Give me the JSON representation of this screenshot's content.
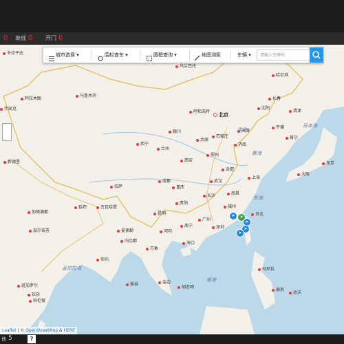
{
  "status": {
    "items": [
      {
        "label": "",
        "value": "0"
      },
      {
        "label": "离线",
        "value": "0"
      },
      {
        "label": "开门",
        "value": "0"
      }
    ]
  },
  "toolbar": {
    "city_select": "城市选择",
    "fence_search": "围栏查车",
    "box_search": "圆框查询",
    "measure": "地图测距",
    "vehicle_label": "车辆",
    "plate_placeholder": "请输入车牌号"
  },
  "map": {
    "labels": [
      {
        "text": "卡拉干达",
        "kind": "city"
      },
      {
        "text": "乌兰巴托",
        "kind": "city"
      },
      {
        "text": "哈尔滨",
        "kind": "city"
      },
      {
        "text": "乌鲁木齐",
        "kind": "city"
      },
      {
        "text": "长春",
        "kind": "city"
      },
      {
        "text": "阿拉木图",
        "kind": "city"
      },
      {
        "text": "什凯克",
        "kind": "city"
      },
      {
        "text": "北京",
        "kind": "capital"
      },
      {
        "text": "沈阳",
        "kind": "city"
      },
      {
        "text": "呼和浩特",
        "kind": "city"
      },
      {
        "text": "清津",
        "kind": "city"
      },
      {
        "text": "银川",
        "kind": "city"
      },
      {
        "text": "太原",
        "kind": "city"
      },
      {
        "text": "石家庄",
        "kind": "city"
      },
      {
        "text": "天津",
        "kind": "city"
      },
      {
        "text": "平壤",
        "kind": "city"
      },
      {
        "text": "渤海",
        "kind": "sea"
      },
      {
        "text": "首尔",
        "kind": "city"
      },
      {
        "text": "济南",
        "kind": "city"
      },
      {
        "text": "日本海",
        "kind": "sea"
      },
      {
        "text": "西宁",
        "kind": "city"
      },
      {
        "text": "兰州",
        "kind": "city"
      },
      {
        "text": "郑州",
        "kind": "city"
      },
      {
        "text": "黄海",
        "kind": "sea"
      },
      {
        "text": "西安",
        "kind": "city"
      },
      {
        "text": "合肥",
        "kind": "city"
      },
      {
        "text": "上海",
        "kind": "city"
      },
      {
        "text": "拉萨",
        "kind": "city"
      },
      {
        "text": "成都",
        "kind": "city"
      },
      {
        "text": "武汉",
        "kind": "city"
      },
      {
        "text": "重庆",
        "kind": "city"
      },
      {
        "text": "南昌",
        "kind": "city"
      },
      {
        "text": "长沙",
        "kind": "city"
      },
      {
        "text": "贵阳",
        "kind": "city"
      },
      {
        "text": "福州",
        "kind": "city"
      },
      {
        "text": "东海",
        "kind": "sea"
      },
      {
        "text": "加德满都",
        "kind": "city"
      },
      {
        "text": "廷布",
        "kind": "city"
      },
      {
        "text": "古瓦哈提",
        "kind": "city"
      },
      {
        "text": "昆明",
        "kind": "city"
      },
      {
        "text": "广州",
        "kind": "city"
      },
      {
        "text": "南宁",
        "kind": "city"
      },
      {
        "text": "深圳",
        "kind": "city"
      },
      {
        "text": "台北",
        "kind": "city"
      },
      {
        "text": "曼德勒",
        "kind": "city"
      },
      {
        "text": "河内",
        "kind": "city"
      },
      {
        "text": "海口",
        "kind": "city"
      },
      {
        "text": "加尔各答",
        "kind": "city"
      },
      {
        "text": "内比都",
        "kind": "city"
      },
      {
        "text": "万象",
        "kind": "city"
      },
      {
        "text": "仰光",
        "kind": "city"
      },
      {
        "text": "孟加拉湾",
        "kind": "sea"
      },
      {
        "text": "南海",
        "kind": "sea"
      },
      {
        "text": "马尼拉",
        "kind": "city"
      },
      {
        "text": "曼谷",
        "kind": "city"
      },
      {
        "text": "金边",
        "kind": "city"
      },
      {
        "text": "胡志明",
        "kind": "city"
      },
      {
        "text": "班加罗尔",
        "kind": "city"
      },
      {
        "text": "钦奈",
        "kind": "city"
      },
      {
        "text": "科伦坡",
        "kind": "city"
      },
      {
        "text": "宿务",
        "kind": "city"
      },
      {
        "text": "达沃",
        "kind": "city"
      },
      {
        "text": "新德里",
        "kind": "city"
      },
      {
        "text": "东京",
        "kind": "city"
      },
      {
        "text": "大阪",
        "kind": "city"
      }
    ]
  },
  "attribution": {
    "leaflet": "Leaflet",
    "sep1": "| © ",
    "osm": "OpenStreetMap",
    "amp": "&",
    "here": "HERE"
  },
  "footer": {
    "left": "他",
    "count": "5",
    "help": "?"
  }
}
